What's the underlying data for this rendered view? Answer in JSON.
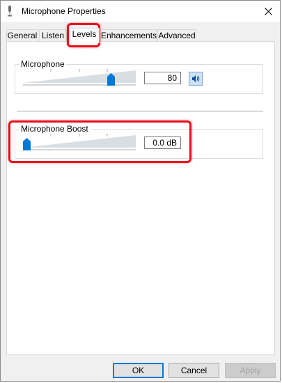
{
  "window": {
    "title": "Microphone Properties"
  },
  "tabs": [
    {
      "label": "General",
      "active": false
    },
    {
      "label": "Listen",
      "active": false
    },
    {
      "label": "Levels",
      "active": true
    },
    {
      "label": "Enhancements",
      "active": false
    },
    {
      "label": "Advanced",
      "active": false
    }
  ],
  "microphone": {
    "label": "Microphone",
    "value": "80",
    "level_percent": 80,
    "icon": "speaker-volume-icon"
  },
  "boost": {
    "label": "Microphone Boost",
    "value": "0.0 dB",
    "level_percent": 0
  },
  "buttons": {
    "ok": "OK",
    "cancel": "Cancel",
    "apply": "Apply"
  },
  "colors": {
    "accent": "#0078d7",
    "annotation": "#e8101b",
    "slider_track": "#d9dee3"
  }
}
